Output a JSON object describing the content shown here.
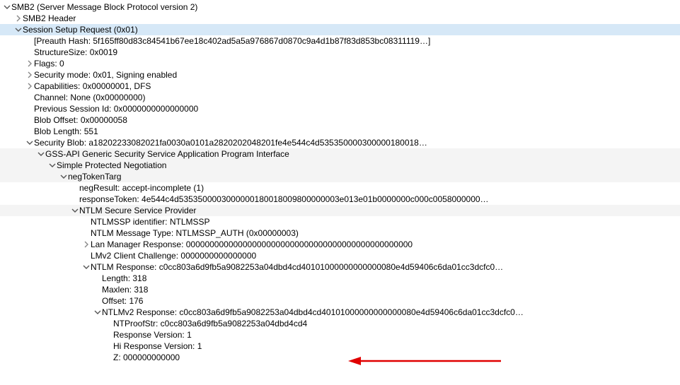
{
  "root": {
    "label": "SMB2 (Server Message Block Protocol version 2)",
    "header": "SMB2 Header",
    "ssr": {
      "label": "Session Setup Request (0x01)",
      "preauth": "[Preauth Hash: 5f165ff80d83c84541b67ee18c402ad5a5a976867d0870c9a4d1b87f83d853bc08311119…]",
      "structsize": "StructureSize: 0x0019",
      "flags": "Flags: 0",
      "secmode": "Security mode: 0x01, Signing enabled",
      "caps": "Capabilities: 0x00000001, DFS",
      "channel": "Channel: None (0x00000000)",
      "prevsess": "Previous Session Id: 0x0000000000000000",
      "bloboff": "Blob Offset: 0x00000058",
      "bloblen": "Blob Length: 551",
      "secblob": {
        "label": "Security Blob: a18202233082021fa0030a0101a2820202048201fe4e544c4d535350000300000180018…",
        "gss": {
          "label": "GSS-API Generic Security Service Application Program Interface",
          "spn": {
            "label": "Simple Protected Negotiation",
            "ntt": {
              "label": "negTokenTarg",
              "negresult": "negResult: accept-incomplete (1)",
              "resptoken": "responseToken: 4e544c4d5353500003000000180018009800000003e013e01b0000000c000c0058000000…",
              "nssp": {
                "label": "NTLM Secure Service Provider",
                "ident": "NTLMSSP identifier: NTLMSSP",
                "msgtype": "NTLM Message Type: NTLMSSP_AUTH (0x00000003)",
                "lanman": "Lan Manager Response: 000000000000000000000000000000000000000000000000",
                "lmv2cc": "LMv2 Client Challenge: 0000000000000000",
                "ntlmresp": {
                  "label": "NTLM Response: c0cc803a6d9fb5a9082253a04dbd4cd40101000000000000080e4d59406c6da01cc3dcfc0…",
                  "length": "Length: 318",
                  "maxlen": "Maxlen: 318",
                  "offset": "Offset: 176",
                  "v2": {
                    "label": "NTLMv2 Response: c0cc803a6d9fb5a9082253a04dbd4cd40101000000000000080e4d59406c6da01cc3dcfc0…",
                    "ntproof": "NTProofStr: c0cc803a6d9fb5a9082253a04dbd4cd4",
                    "rv": "Response Version: 1",
                    "hrv": "Hi Response Version: 1",
                    "z": "Z: 000000000000"
                  }
                }
              }
            }
          }
        }
      }
    }
  }
}
